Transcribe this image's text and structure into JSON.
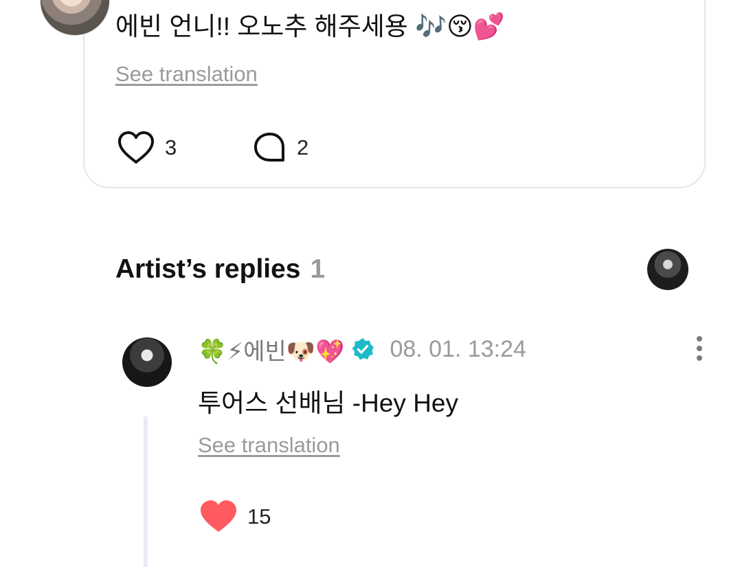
{
  "post": {
    "text": "에빈 언니!! 오노추 해주세용 🎶😚💕",
    "see_translation": "See translation",
    "likes": "3",
    "comments": "2"
  },
  "artist_replies": {
    "title": "Artist’s replies",
    "count": "1"
  },
  "reply": {
    "name": "🍀⚡에빈🐶💖",
    "timestamp": "08. 01. 13:24",
    "text": "투어스 선배님 -Hey Hey",
    "see_translation": "See translation",
    "likes": "15"
  },
  "colors": {
    "heart_filled": "#ff5a5f",
    "verified": "#1dbac9",
    "muted_text": "#9a9a9a"
  }
}
